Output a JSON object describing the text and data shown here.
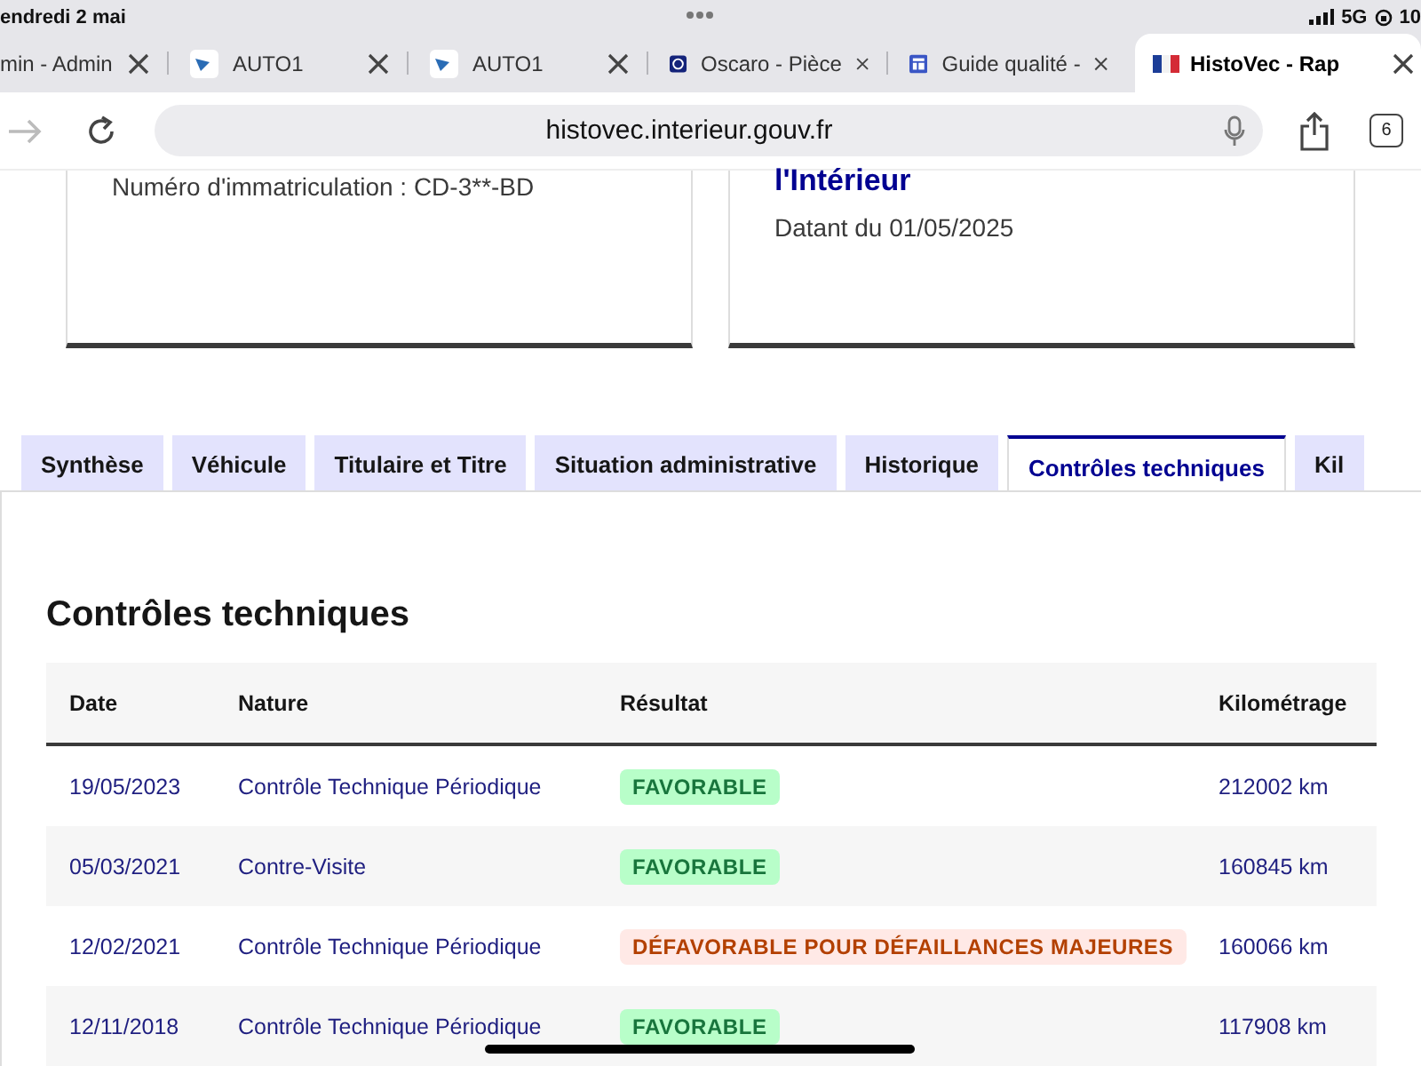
{
  "status_bar": {
    "date": "endredi 2 mai",
    "network": "5G",
    "battery": "10"
  },
  "browser_tabs": [
    {
      "title": "min - Admin",
      "kind": "none",
      "selected": false
    },
    {
      "title": "AUTO1",
      "kind": "arrow",
      "selected": false
    },
    {
      "title": "AUTO1",
      "kind": "arrow",
      "selected": false
    },
    {
      "title": "Oscaro - Pièce",
      "kind": "circle",
      "selected": false
    },
    {
      "title": "Guide qualité -",
      "kind": "layout",
      "selected": false
    },
    {
      "title": "HistoVec - Rap",
      "kind": "flag",
      "selected": true
    }
  ],
  "address_bar": {
    "url": "histovec.interieur.gouv.fr",
    "tab_count": "6"
  },
  "cards": [
    {
      "text": "Numéro d'immatriculation : CD-3**-BD"
    },
    {
      "heading": "l'Intérieur",
      "text": "Datant du 01/05/2025"
    }
  ],
  "page_tabs": [
    {
      "label": "Synthèse",
      "selected": false
    },
    {
      "label": "Véhicule",
      "selected": false
    },
    {
      "label": "Titulaire et Titre",
      "selected": false
    },
    {
      "label": "Situation administrative",
      "selected": false
    },
    {
      "label": "Historique",
      "selected": false
    },
    {
      "label": "Contrôles techniques",
      "selected": true
    },
    {
      "label": "Kil",
      "selected": false
    }
  ],
  "section_title": "Contrôles techniques",
  "table": {
    "columns": [
      "Date",
      "Nature",
      "Résultat",
      "Kilométrage"
    ],
    "rows": [
      {
        "date": "19/05/2023",
        "nature": "Contrôle Technique Périodique",
        "result": "FAVORABLE",
        "kind": "success",
        "mileage": "212002 km"
      },
      {
        "date": "05/03/2021",
        "nature": "Contre-Visite",
        "result": "FAVORABLE",
        "kind": "success",
        "mileage": "160845 km"
      },
      {
        "date": "12/02/2021",
        "nature": "Contrôle Technique Périodique",
        "result": "DÉFAVORABLE POUR DÉFAILLANCES MAJEURES",
        "kind": "error",
        "mileage": "160066 km"
      },
      {
        "date": "12/11/2018",
        "nature": "Contrôle Technique Périodique",
        "result": "FAVORABLE",
        "kind": "success",
        "mileage": "117908 km"
      }
    ]
  }
}
